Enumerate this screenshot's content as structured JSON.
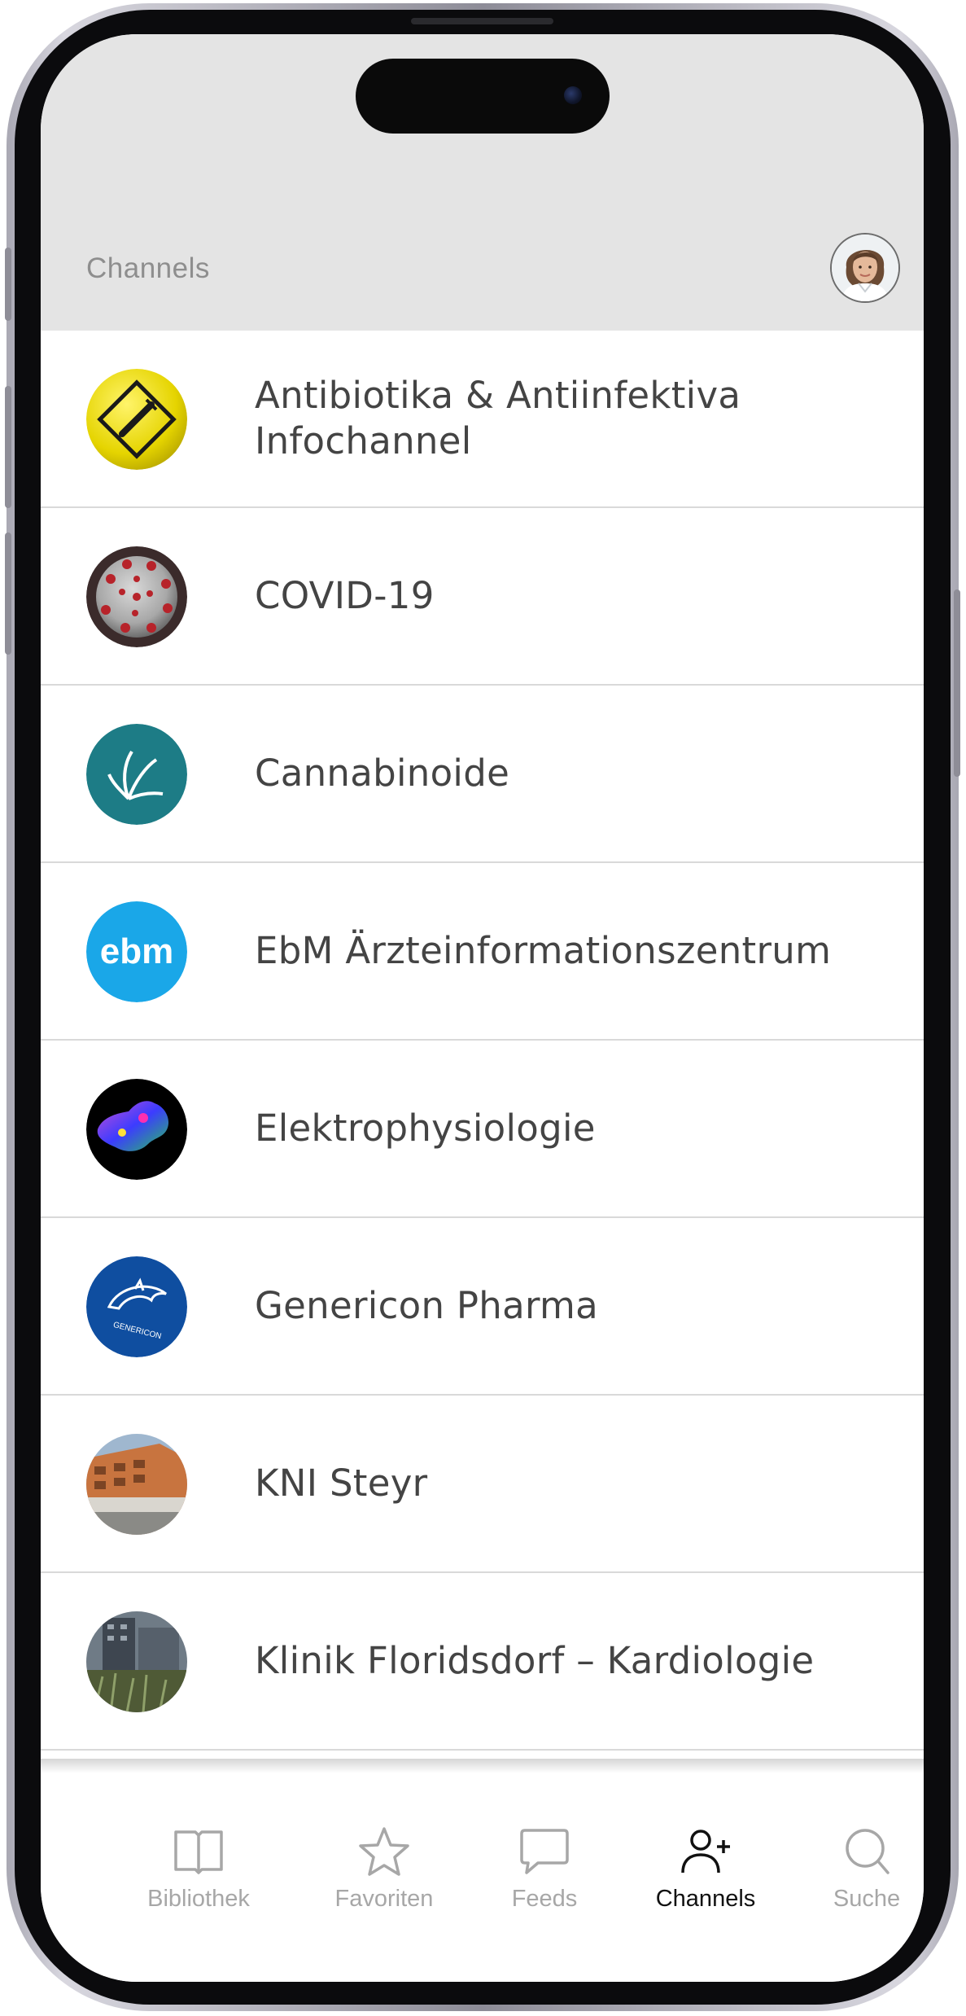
{
  "header": {
    "title": "Channels"
  },
  "channels": [
    {
      "name": "Antibiotika & Antiinfektiva Infochannel",
      "logo": "syringe-sign-icon"
    },
    {
      "name": "COVID-19",
      "logo": "virus-icon"
    },
    {
      "name": "Cannabinoide",
      "logo": "cannabis-leaf-icon"
    },
    {
      "name": "EbM Ärzteinformationszentrum",
      "logo": "ebm-logo",
      "logo_text": "ebm"
    },
    {
      "name": "Elektrophysiologie",
      "logo": "heart-map-icon"
    },
    {
      "name": "Genericon Pharma",
      "logo": "dolphin-icon",
      "logo_text": "GENERICON"
    },
    {
      "name": "KNI Steyr",
      "logo": "building-photo"
    },
    {
      "name": "Klinik Floridsdorf – Kardiologie",
      "logo": "clinic-photo"
    }
  ],
  "tabs": [
    {
      "label": "Bibliothek",
      "icon": "book-icon",
      "active": false
    },
    {
      "label": "Favoriten",
      "icon": "star-icon",
      "active": false
    },
    {
      "label": "Feeds",
      "icon": "chat-bubble-icon",
      "active": false
    },
    {
      "label": "Channels",
      "icon": "person-add-icon",
      "active": true
    },
    {
      "label": "Suche",
      "icon": "search-icon",
      "active": false
    }
  ],
  "colors": {
    "header_bg": "#e4e4e4",
    "text": "#444444",
    "tab_inactive": "#a7a7a7",
    "tab_active": "#111111"
  }
}
